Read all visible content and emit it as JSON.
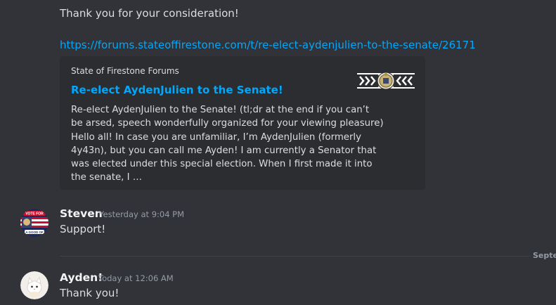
{
  "message1": {
    "text": "Thank you for your consideration!",
    "link": "https://forums.stateoffirestone.com/t/re-elect-aydenjulien-to-the-senate/26171"
  },
  "embed": {
    "provider": "State of Firestone Forums",
    "title": "Re-elect AydenJulien to the Senate!",
    "description_lines": [
      "Re-elect AydenJulien to the Senate! (tl;dr at the end if you can’t",
      "be arsed, speech wonderfully organized for your viewing pleasure)",
      "Hello all! In case you are unfamiliar, I’m AydenJulien (formerly",
      "4y43n), but you can call me Ayden! I am currently a Senator that",
      "was elected under this special election. When I first made it into",
      "the senate, I …"
    ]
  },
  "message2": {
    "username": "Steven",
    "timestamp": "Yesterday at 9:04 PM",
    "text": "Support!",
    "avatar_badge_text": [
      "VOTE FOR",
      "A GOOD OF"
    ]
  },
  "date_divider": {
    "label": "Septer"
  },
  "message3": {
    "username": "Ayden!",
    "timestamp": "Today at 12:06 AM",
    "text": "Thank you!"
  },
  "colors": {
    "background": "#313338",
    "embed_background": "#2b2d31",
    "link": "#00a8fc",
    "text": "#dbdee1",
    "muted": "#949ba4"
  }
}
